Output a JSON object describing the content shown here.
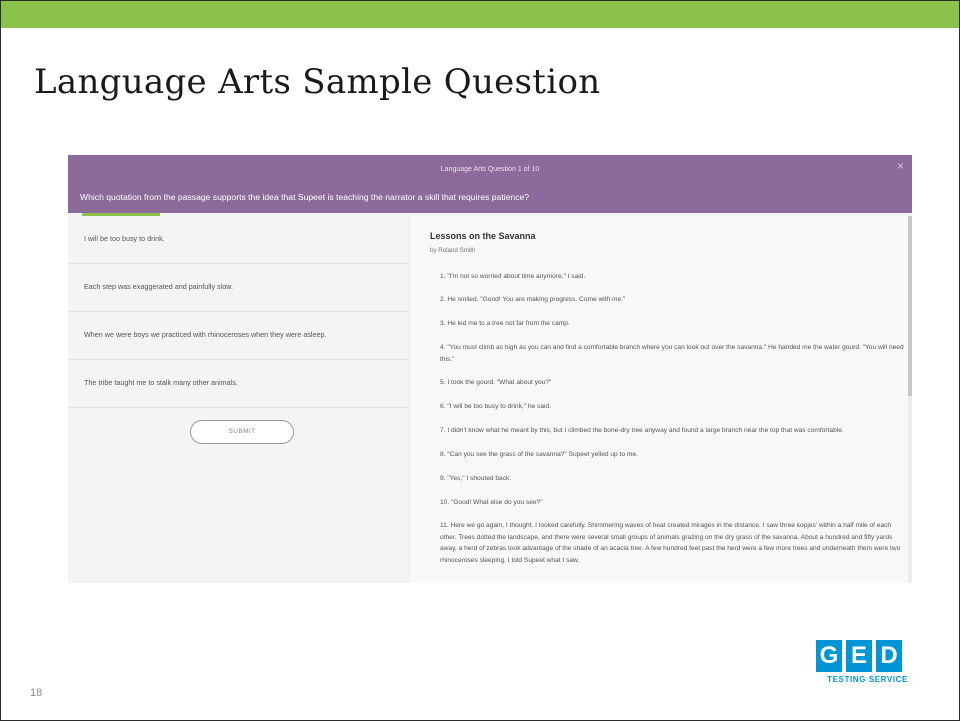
{
  "slide": {
    "title": "Language Arts Sample Question",
    "page_number": "18"
  },
  "question": {
    "counter": "Language Arts Question 1 of 10",
    "prompt": "Which quotation from the passage supports the idea that Supeet is teaching the narrator a skill that requires patience?",
    "close": "×"
  },
  "answers": [
    "I will be too busy to drink.",
    "Each step was exaggerated and painfully slow.",
    "When we were boys we practiced with rhinoceroses when they were asleep.",
    "The tribe taught me to stalk many other animals."
  ],
  "submit_label": "SUBMIT",
  "passage": {
    "title": "Lessons on the Savanna",
    "author": "by Roland Smith",
    "lines": [
      "1. \"I'm not so worried about time anymore,\" I said.",
      "2. He smiled. \"Good! You are making progress. Come with me.\"",
      "3. He led me to a tree not far from the camp.",
      "4. \"You must climb as high as you can and find a comfortable branch where you can look out over the savanna.\" He handed me the water gourd. \"You will need this.\"",
      "5. I took the gourd. \"What about you?\"",
      "6. \"I will be too busy to drink,\" he said.",
      "7. I didn't know what he meant by this, but I climbed the bone-dry tree anyway and found a large branch near the top that was comfortable.",
      "8. \"Can you see the grass of the savanna?\" Supeet yelled up to me.",
      "9. \"Yes,\" I shouted back.",
      "10. \"Good! What else do you see?\"",
      "11. Here we go again, I thought. I looked carefully. Shimmering waves of heat created mirages in the distance. I saw three kopjes' within a half mile of each other. Trees dotted the landscape, and there were several small groups of animals grazing on the dry grass of the savanna. About a hundred and fifty yards away, a herd of zebras took advantage of the shade of an acacia tree. A few hundred feet past the herd were a few more trees and underneath them were two rhinoceroses sleeping. I told Supeet what I saw."
    ]
  },
  "logo": {
    "letters": [
      "G",
      "E",
      "D"
    ],
    "subtitle": "TESTING SERVICE",
    "color": "#0096d6"
  },
  "colors": {
    "accent_bar": "#8bc34a",
    "header": "#8c6a9a"
  }
}
